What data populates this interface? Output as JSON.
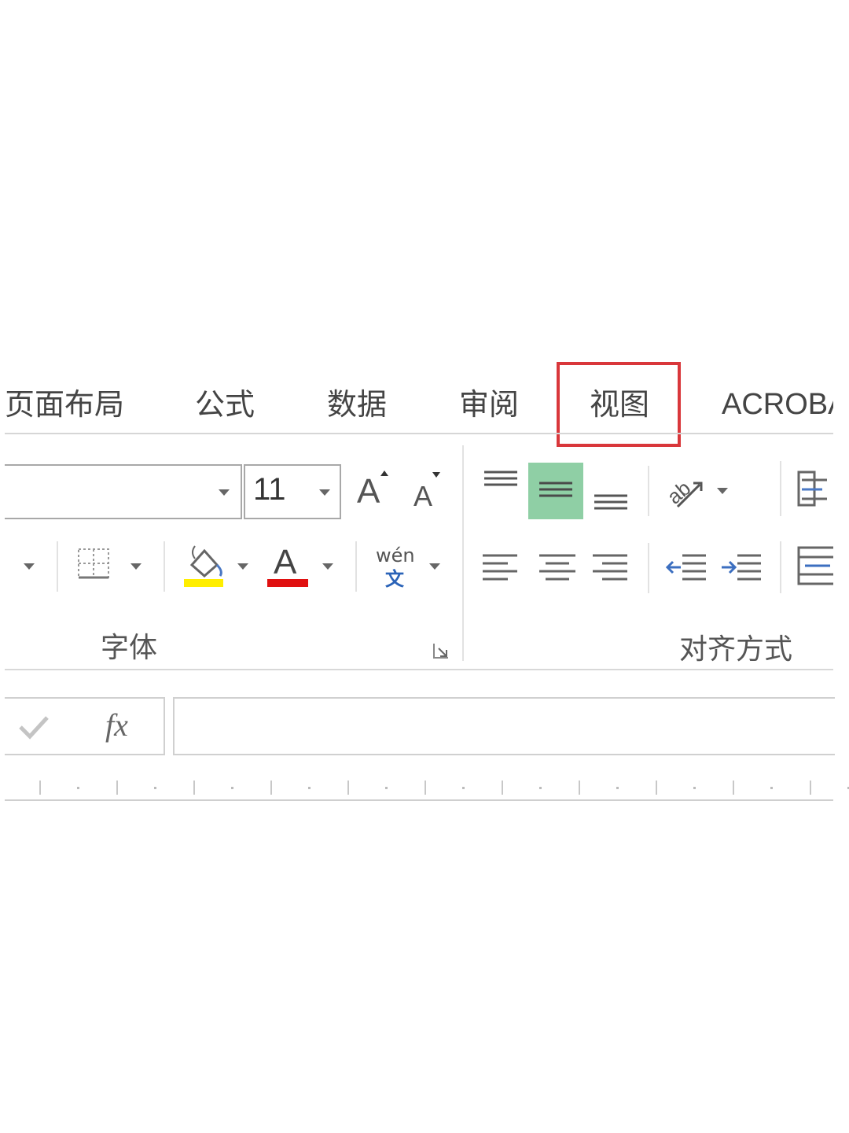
{
  "ribbon": {
    "tabs": [
      {
        "label": "页面布局"
      },
      {
        "label": "公式"
      },
      {
        "label": "数据"
      },
      {
        "label": "审阅"
      },
      {
        "label": "视图",
        "highlighted": true
      },
      {
        "label": "ACROBA"
      }
    ],
    "highlight_color": "#d9373b"
  },
  "font_group": {
    "font_name": "",
    "font_size": "11",
    "label": "字体",
    "phonetic_text": "wén",
    "phonetic_char": "文",
    "fill_color": "#ffee00",
    "font_color": "#e01010",
    "increase_font_label": "A",
    "decrease_font_label": "A",
    "font_color_letter": "A"
  },
  "alignment_group": {
    "label": "对齐方式",
    "selected_color": "#8fcfa5"
  },
  "formula_bar": {
    "fx_label": "fx",
    "value": ""
  }
}
